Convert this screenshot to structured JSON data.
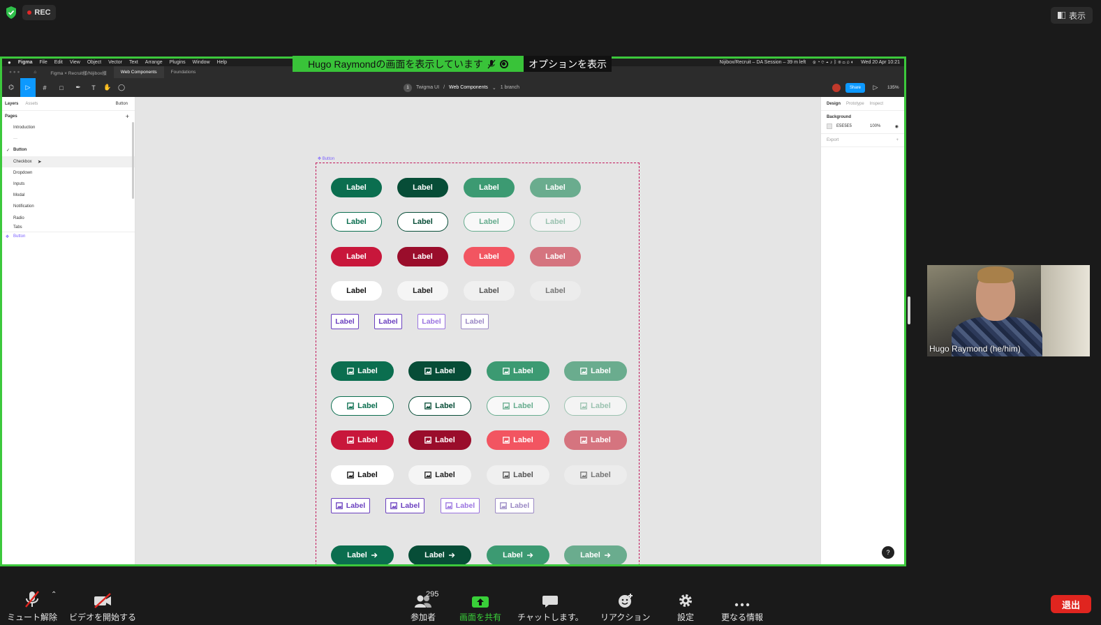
{
  "zoom_top": {
    "rec_label": "REC",
    "view_label": "表示"
  },
  "share_banner": {
    "text": "Hugo Raymondの画面を表示しています",
    "options_label": "オプションを表示"
  },
  "mac_menu": {
    "items": [
      "Figma",
      "File",
      "Edit",
      "View",
      "Object",
      "Vector",
      "Text",
      "Arrange",
      "Plugins",
      "Window",
      "Help"
    ],
    "session": "Nijibox/Recruit – DA Session – 39 m left",
    "clock": "Wed 20 Apr  10:21"
  },
  "figma": {
    "tabs": [
      "Figma × Recruit様/Nijibox様",
      "Web Components",
      "Foundations"
    ],
    "breadcrumb": {
      "badge": "1",
      "team": "Twigma UI",
      "file": "Web Components",
      "branch": "1 branch"
    },
    "share_label": "Share",
    "zoom_level": "135%",
    "left_panel": {
      "tab_layers": "Layers",
      "tab_assets": "Assets",
      "page_switch": "Button",
      "pages_heading": "Pages",
      "pages": [
        "Introduction",
        "---",
        "Button",
        "Checkbox",
        "Dropdown",
        "Inputs",
        "Modal",
        "Notification",
        "Radio",
        "Tabs"
      ],
      "selected_page": "Button",
      "layer": "Button"
    },
    "right_panel": {
      "tab_design": "Design",
      "tab_prototype": "Prototype",
      "tab_inspect": "Inspect",
      "bg_heading": "Background",
      "bg_hex": "E5E5E5",
      "bg_opacity": "100%",
      "export_label": "Export"
    },
    "frame_label": "Button",
    "button_label": "Label",
    "colors": {
      "green": "#0b6e4f",
      "green_dark": "#074d37",
      "green_mid": "#3c9a72",
      "green_light": "#6aac8e",
      "red": "#c8173b",
      "red_dark": "#9a0d2b",
      "red_light": "#f25561",
      "red_pale": "#d5747f",
      "purple": "#6a3fbf"
    }
  },
  "video": {
    "name": "Hugo Raymond (he/him)"
  },
  "zoom_bar": {
    "mute": "ミュート解除",
    "video": "ビデオを開始する",
    "participants": "参加者",
    "participant_count": "295",
    "share": "画面を共有",
    "chat": "チャットします。",
    "reactions": "リアクション",
    "settings": "設定",
    "more": "更なる情報",
    "leave": "退出"
  }
}
